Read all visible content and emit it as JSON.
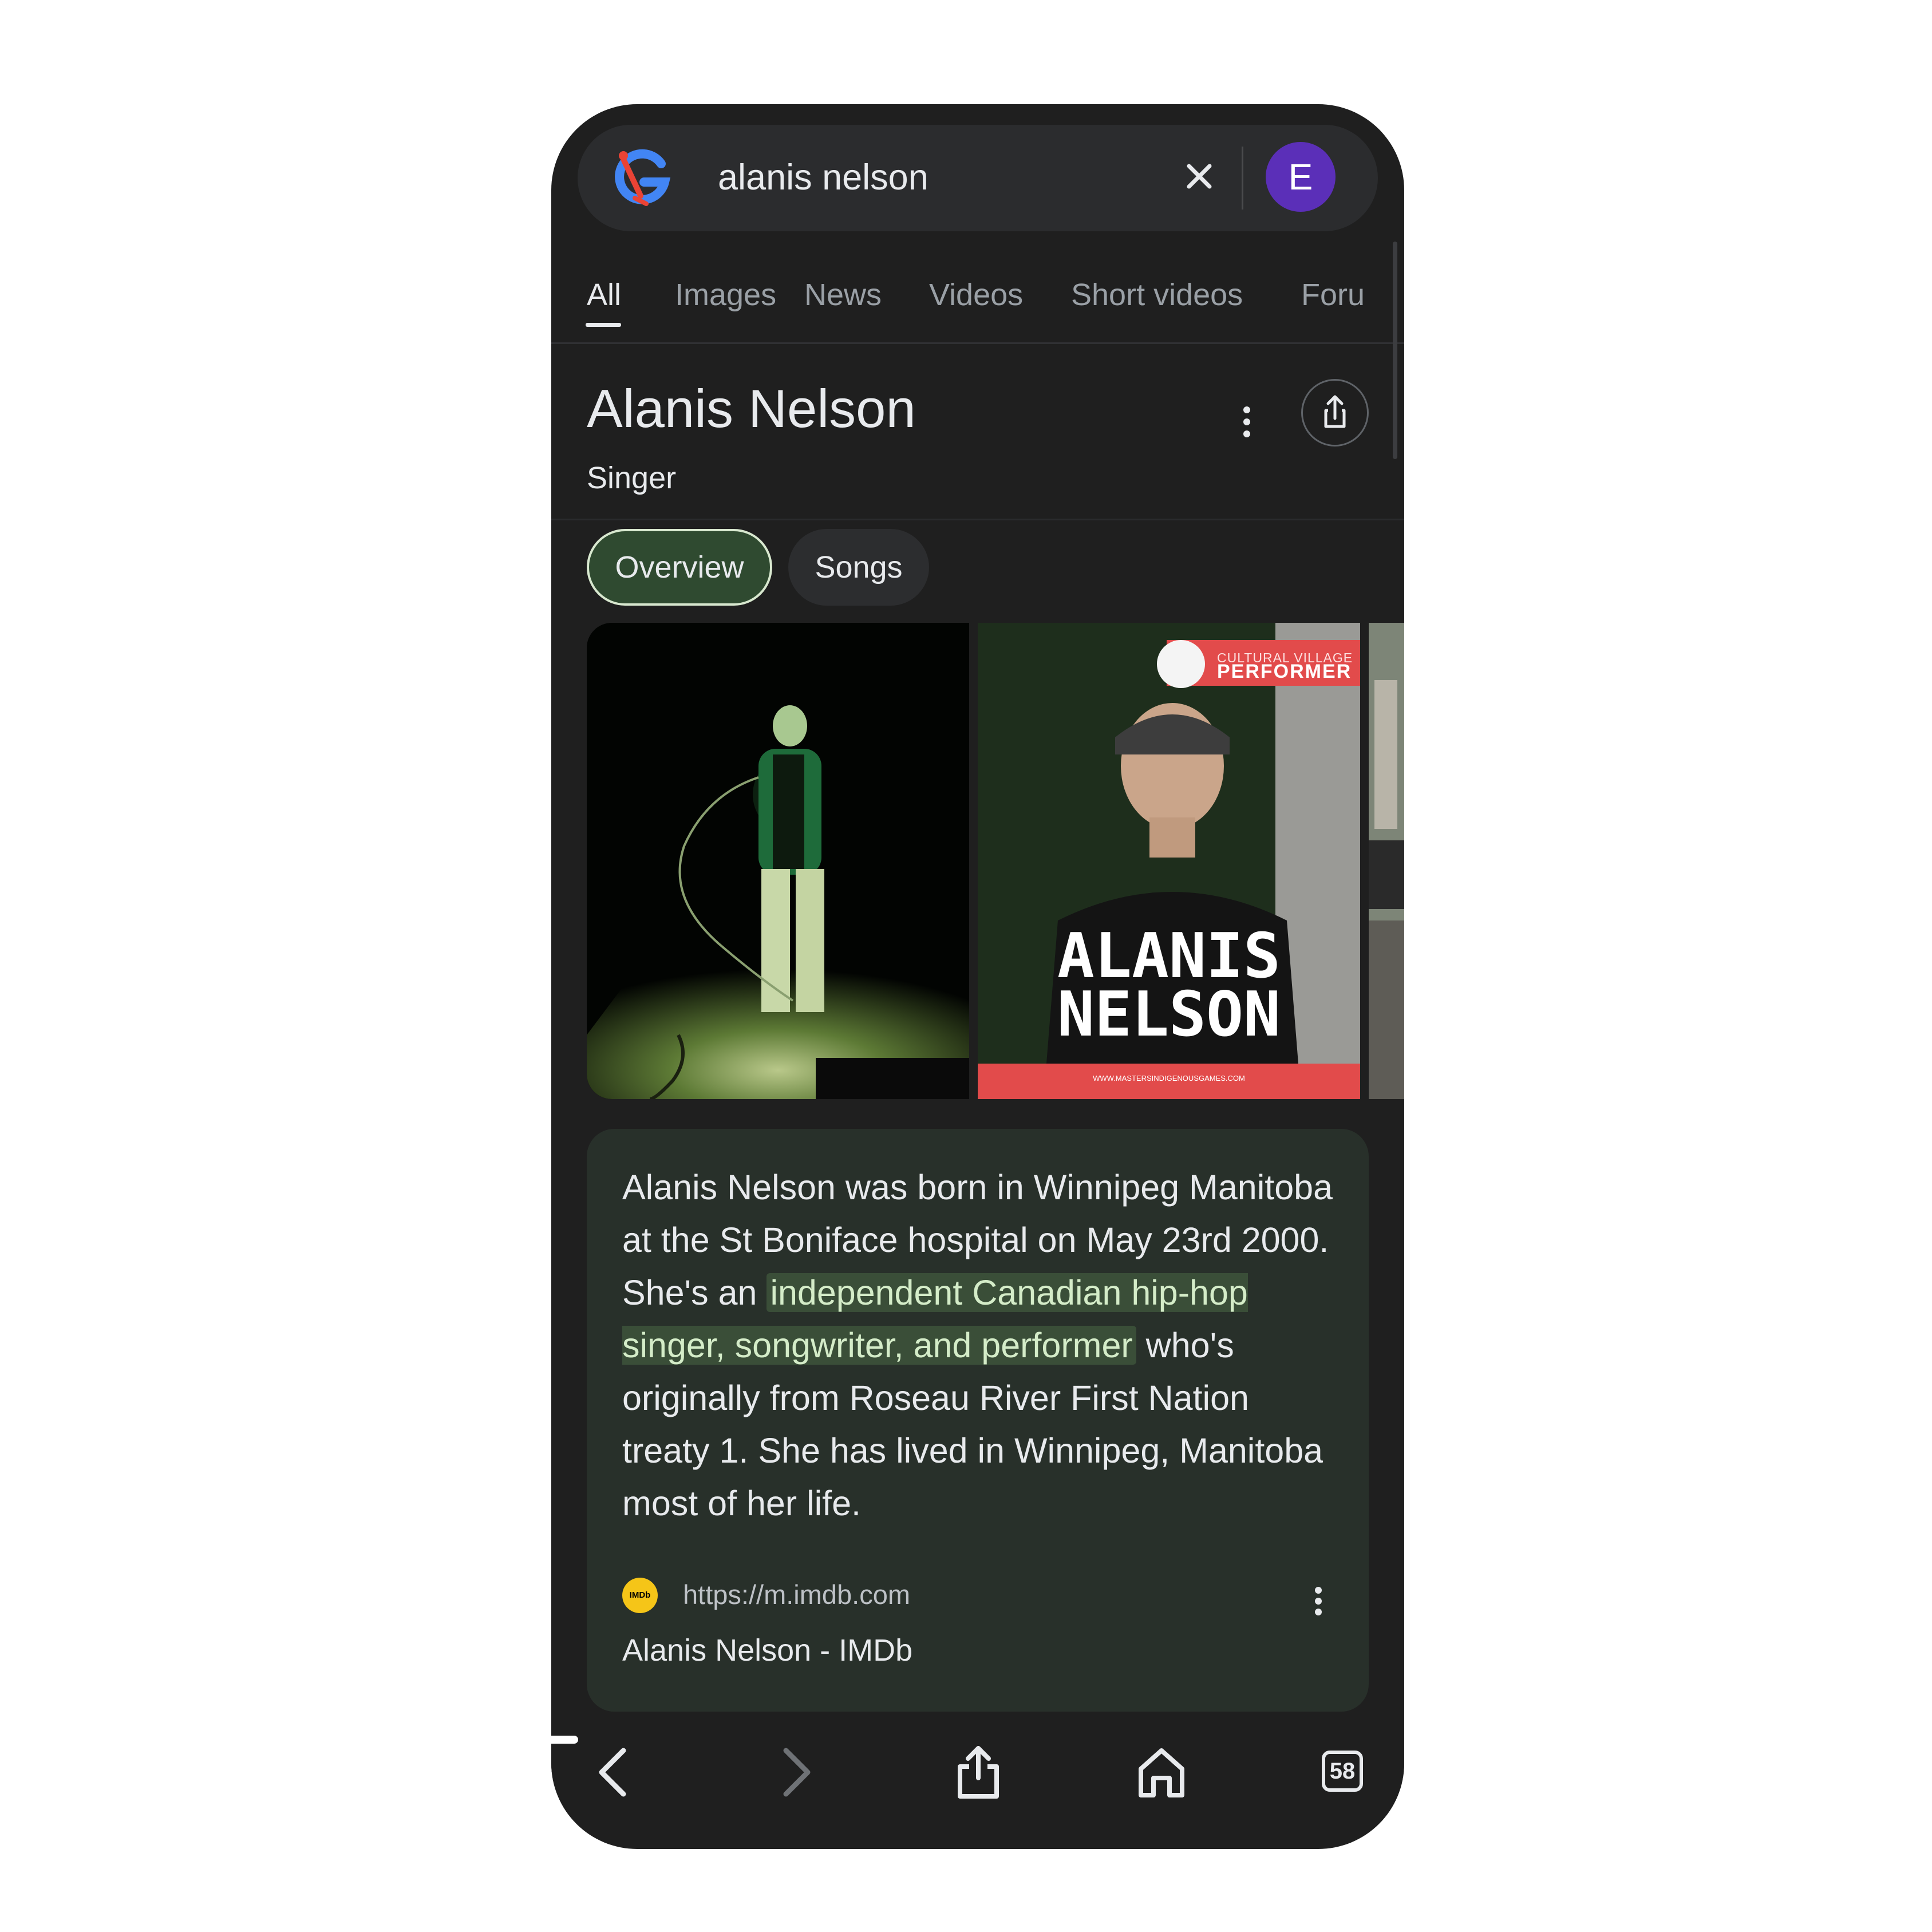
{
  "search": {
    "query": "alanis nelson",
    "avatar_letter": "E"
  },
  "tabs": [
    {
      "label": "All",
      "active": true
    },
    {
      "label": "Images"
    },
    {
      "label": "News"
    },
    {
      "label": "Videos"
    },
    {
      "label": "Short videos"
    },
    {
      "label": "Foru"
    }
  ],
  "entity": {
    "title": "Alanis Nelson",
    "subtitle": "Singer"
  },
  "chips": [
    {
      "label": "Overview",
      "selected": true
    },
    {
      "label": "Songs"
    }
  ],
  "images": {
    "poster_badge_line1": "CULTURAL VILLAGE",
    "poster_badge_line2": "PERFORMER",
    "poster_name_line1": "ALANIS",
    "poster_name_line2": "NELSON",
    "poster_footer": "WWW.MASTERSINDIGENOUSGAMES.COM"
  },
  "description": {
    "before": "Alanis Nelson was born in Winnipeg Manitoba at the St Boniface hospital on May 23rd 2000. She's an ",
    "highlight": "independent Canadian hip-hop singer, songwriter, and performer",
    "after": " who's originally from Roseau River First Nation treaty 1. She has lived in Winnipeg, Manitoba most of her life."
  },
  "source": {
    "logo_text": "IMDb",
    "url": "https://m.imdb.com",
    "title": "Alanis Nelson - IMDb"
  },
  "bottom_nav": {
    "tab_count": "58"
  },
  "colors": {
    "background": "#1f1f1f",
    "chip_selected": "#2f4a30",
    "highlight": "#3a4e38",
    "avatar": "#5b2fb8",
    "imdb": "#f5c518"
  }
}
